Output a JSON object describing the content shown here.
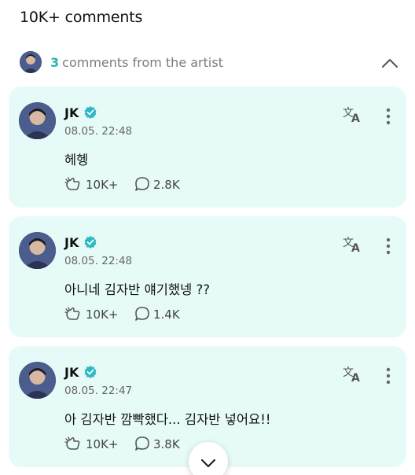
{
  "header": {
    "title": "10K+ comments"
  },
  "artist_row": {
    "count": "3",
    "label": "comments from the artist"
  },
  "comments": [
    {
      "name": "JK",
      "time": "08.05. 22:48",
      "text": "헤헹",
      "likes": "10K+",
      "replies": "2.8K"
    },
    {
      "name": "JK",
      "time": "08.05. 22:48",
      "text": "아니네 김자반 얘기했넹 ??",
      "likes": "10K+",
      "replies": "1.4K"
    },
    {
      "name": "JK",
      "time": "08.05. 22:47",
      "text": "아 김자반 깜빡했다... 김자반 넣어요!!",
      "likes": "10K+",
      "replies": "3.8K"
    }
  ],
  "colors": {
    "accent": "#27b5b1",
    "card_bg": "#e6fbf7",
    "verified": "#2bb9c6"
  }
}
